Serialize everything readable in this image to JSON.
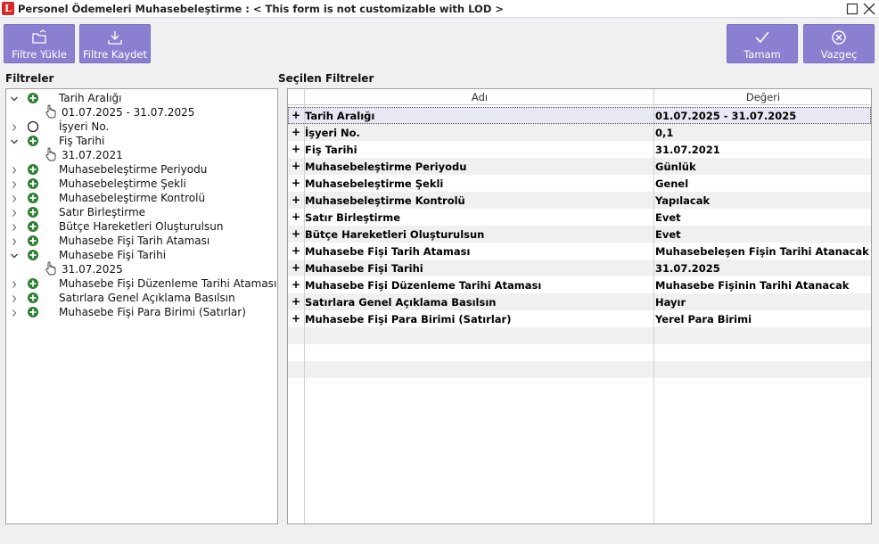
{
  "window": {
    "title": "Personel Ödemeleri Muhasebeleştirme : < This form is not customizable with LOD >",
    "logo_letter": "L"
  },
  "toolbar": {
    "load_filter": "Filtre Yükle",
    "save_filter": "Filtre Kaydet",
    "ok": "Tamam",
    "cancel": "Vazgeç"
  },
  "colors": {
    "button_bg": "#8a7fd0",
    "logo_red": "#d62828",
    "node_green": "#2e7d32"
  },
  "filters_panel": {
    "title": "Filtreler",
    "items": [
      {
        "label": "Tarih Aralığı",
        "expanded": true,
        "icon": "green-plus-icon",
        "value": "01.07.2025 - 31.07.2025"
      },
      {
        "label": "İşyeri No.",
        "expanded": false,
        "icon": "circle-icon"
      },
      {
        "label": "Fiş Tarihi",
        "expanded": true,
        "icon": "green-plus-icon",
        "value": "31.07.2021"
      },
      {
        "label": "Muhasebeleştirme Periyodu",
        "expanded": false,
        "icon": "green-plus-icon"
      },
      {
        "label": "Muhasebeleştirme Şekli",
        "expanded": false,
        "icon": "green-plus-icon"
      },
      {
        "label": "Muhasebeleştirme Kontrolü",
        "expanded": false,
        "icon": "green-plus-icon"
      },
      {
        "label": "Satır Birleştirme",
        "expanded": false,
        "icon": "green-plus-icon"
      },
      {
        "label": "Bütçe Hareketleri Oluşturulsun",
        "expanded": false,
        "icon": "green-plus-icon"
      },
      {
        "label": "Muhasebe Fişi Tarih Ataması",
        "expanded": false,
        "icon": "green-plus-icon"
      },
      {
        "label": "Muhasebe Fişi Tarihi",
        "expanded": true,
        "icon": "green-plus-icon",
        "value": "31.07.2025"
      },
      {
        "label": "Muhasebe Fişi Düzenleme Tarihi Ataması",
        "expanded": false,
        "icon": "green-plus-icon"
      },
      {
        "label": "Satırlara Genel Açıklama Basılsın",
        "expanded": false,
        "icon": "green-plus-icon"
      },
      {
        "label": "Muhasebe Fişi Para Birimi (Satırlar)",
        "expanded": false,
        "icon": "green-plus-icon"
      }
    ]
  },
  "selected_panel": {
    "title": "Seçilen Filtreler",
    "columns": [
      "Adı",
      "Değeri"
    ],
    "rows": [
      {
        "name": "Tarih Aralığı",
        "value": "01.07.2025 - 31.07.2025"
      },
      {
        "name": "İşyeri No.",
        "value": "0,1"
      },
      {
        "name": "Fiş Tarihi",
        "value": "31.07.2021"
      },
      {
        "name": "Muhasebeleştirme Periyodu",
        "value": "Günlük"
      },
      {
        "name": "Muhasebeleştirme Şekli",
        "value": "Genel"
      },
      {
        "name": "Muhasebeleştirme Kontrolü",
        "value": "Yapılacak"
      },
      {
        "name": "Satır Birleştirme",
        "value": "Evet"
      },
      {
        "name": "Bütçe Hareketleri Oluşturulsun",
        "value": "Evet"
      },
      {
        "name": "Muhasebe Fişi Tarih Ataması",
        "value": "Muhasebeleşen Fişin Tarihi Atanacak"
      },
      {
        "name": "Muhasebe Fişi Tarihi",
        "value": "31.07.2025"
      },
      {
        "name": "Muhasebe Fişi Düzenleme Tarihi Ataması",
        "value": "Muhasebe Fişinin Tarihi Atanacak"
      },
      {
        "name": "Satırlara Genel Açıklama Basılsın",
        "value": "Hayır"
      },
      {
        "name": "Muhasebe Fişi Para Birimi (Satırlar)",
        "value": "Yerel Para Birimi"
      }
    ],
    "row_marker": "+"
  }
}
